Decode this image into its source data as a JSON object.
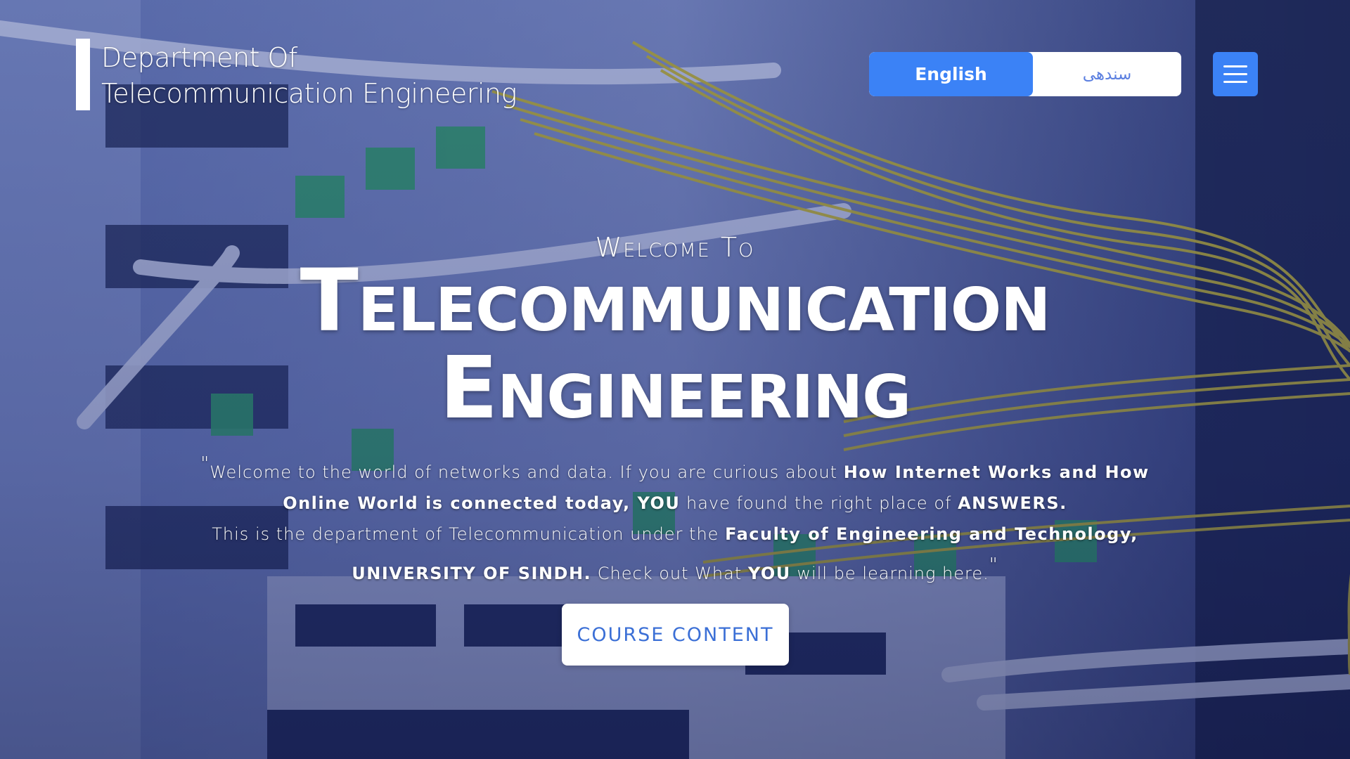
{
  "brand": {
    "line1": "Department Of",
    "line2": "Telecommunication Engineering"
  },
  "language": {
    "english": "English",
    "sindhi": "سندھی",
    "active": "English"
  },
  "menu": {
    "icon": "hamburger-menu-icon"
  },
  "hero": {
    "welcome": "Welcome To",
    "title_line1": "Telecommunication",
    "title_line2": "Engineering"
  },
  "quote": {
    "open_mark": "\"",
    "p1": "Welcome to the world of networks and data. If you are curious about ",
    "p1_bold": "How Internet Works and How Online World is connected today, YOU",
    "p2": " have found the right place of ",
    "p2_bold": "ANSWERS.",
    "p3": "This is the department of Telecommunication under the ",
    "p3_bold": "Faculty of Engineering and Technology, UNIVERSITY OF SINDH.",
    "p4": " Check out What ",
    "p4_bold": "YOU",
    "p5": " will be learning here.",
    "close_mark": "\""
  },
  "cta": {
    "label": "COURSE CONTENT"
  },
  "colors": {
    "accent": "#3b82f6",
    "cta_text": "#3b6fd6",
    "lang_inactive_text": "#5b7fe0"
  }
}
